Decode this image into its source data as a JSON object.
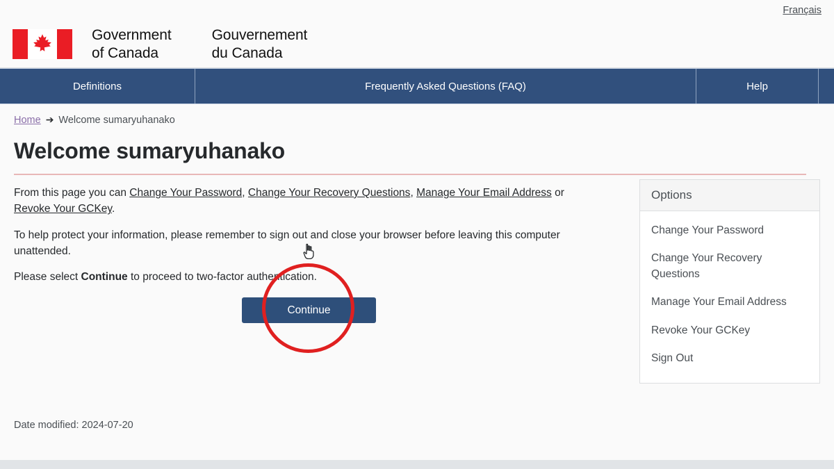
{
  "header": {
    "language_link": "Français",
    "wordmark_en_line1": "Government",
    "wordmark_en_line2": "of Canada",
    "wordmark_fr_line1": "Gouvernement",
    "wordmark_fr_line2": "du Canada",
    "flag_icon": "canada-flag-icon"
  },
  "nav": {
    "items": [
      {
        "label": "Definitions"
      },
      {
        "label": "Frequently Asked Questions (FAQ)"
      },
      {
        "label": "Help"
      }
    ]
  },
  "breadcrumb": {
    "home": "Home",
    "separator": "➔",
    "current": "Welcome sumaryuhanako"
  },
  "main": {
    "title": "Welcome sumaryuhanako",
    "intro": {
      "lead": "From this page you can ",
      "link1": "Change Your Password",
      "sep1": ", ",
      "link2": "Change Your Recovery Questions",
      "sep2": ", ",
      "link3": "Manage Your Email Address",
      "sep3": " or ",
      "link4": "Revoke Your GCKey",
      "end": "."
    },
    "security_notice": "To help protect your information, please remember to sign out and close your browser before leaving this computer unattended.",
    "continue_prompt": {
      "before": "Please select ",
      "bold": "Continue",
      "after": " to proceed to two-factor authentication."
    },
    "continue_button": "Continue"
  },
  "options_panel": {
    "title": "Options",
    "items": [
      {
        "label": "Change Your Password"
      },
      {
        "label": "Change Your Recovery Questions"
      },
      {
        "label": "Manage Your Email Address"
      },
      {
        "label": "Revoke Your GCKey"
      },
      {
        "label": "Sign Out"
      }
    ]
  },
  "footer": {
    "date_modified": "Date modified: 2024-07-20"
  },
  "annotations": {
    "highlight_circle_color": "#e02020",
    "cursor_icon": "pointing-hand-cursor"
  },
  "colors": {
    "nav_blue": "#31507d",
    "button_blue": "#2e4f7a",
    "flag_red": "#ea1d25",
    "title_rule": "#e8b7b7",
    "visited_link": "#8a6ea8"
  }
}
